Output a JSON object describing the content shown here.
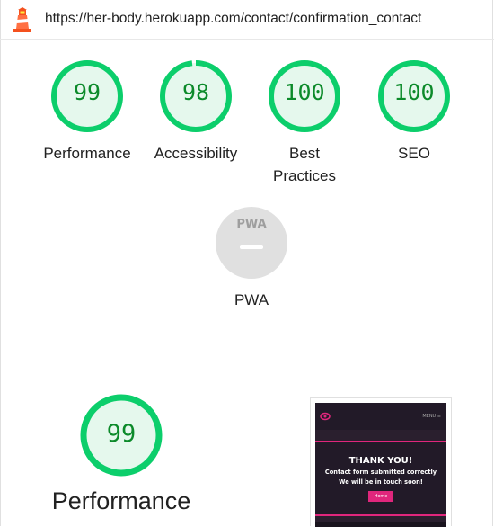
{
  "browser": {
    "url": "https://her-body.herokuapp.com/contact/confirmation_contact"
  },
  "summary_gauges": [
    {
      "score": "99",
      "label": "Performance"
    },
    {
      "score": "98",
      "label": "Accessibility"
    },
    {
      "score": "100",
      "label": "Best Practices"
    },
    {
      "score": "100",
      "label": "SEO"
    }
  ],
  "pwa": {
    "badge": "PWA",
    "label": "PWA"
  },
  "performance_section": {
    "score": "99",
    "title": "Performance"
  },
  "screenshot_thumb": {
    "menu": "MENU ≡",
    "title": "THANK YOU!",
    "line1": "Contact form submitted correctly",
    "line2": "We will be in touch soon!",
    "button": "Home"
  },
  "colors": {
    "pass": "#0cce6b",
    "pass_text": "#0c8a2a",
    "pass_bg": "#e5f8ed",
    "na": "#e0e0e0"
  }
}
